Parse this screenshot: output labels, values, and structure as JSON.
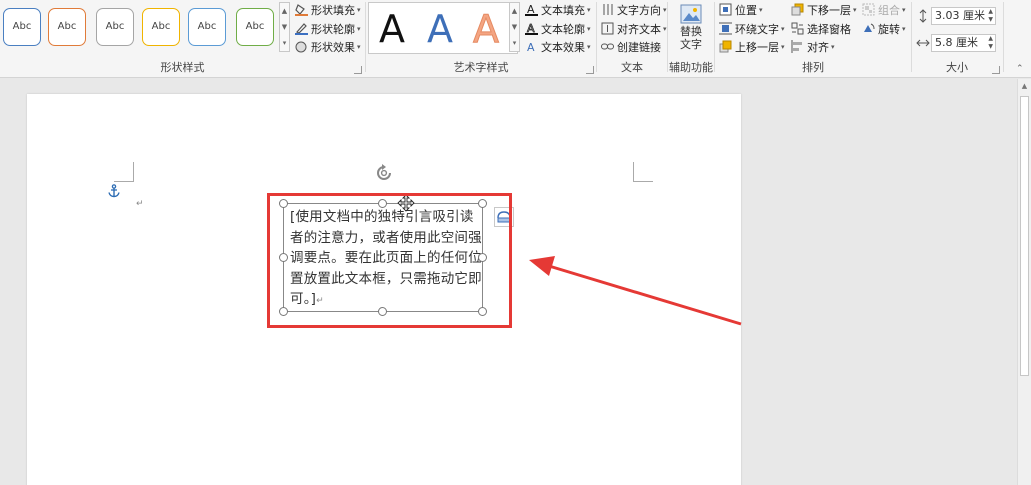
{
  "ribbon": {
    "shape_styles": {
      "label": "形状样式",
      "presets": [
        {
          "text": "Abc",
          "border": "#4a7fc1"
        },
        {
          "text": "Abc",
          "border": "#e07b39"
        },
        {
          "text": "Abc",
          "border": "#a5a5a5"
        },
        {
          "text": "Abc",
          "border": "#f0b400"
        },
        {
          "text": "Abc",
          "border": "#5b9bd5"
        },
        {
          "text": "Abc",
          "border": "#70ad47"
        }
      ],
      "fill": "形状填充",
      "outline": "形状轮廓",
      "effects": "形状效果"
    },
    "wordart": {
      "label": "艺术字样式",
      "samples": [
        {
          "text": "A",
          "color": "#111111"
        },
        {
          "text": "A",
          "color": "#3e6fb8"
        },
        {
          "text": "A",
          "color": "#f4a582"
        }
      ],
      "text_fill": "文本填充",
      "text_outline": "文本轮廓",
      "text_effects": "文本效果"
    },
    "text": {
      "label": "文本",
      "direction": "文字方向",
      "align": "对齐文本",
      "link": "创建链接"
    },
    "accessibility": {
      "label": "辅助功能",
      "alt_text_line1": "替换",
      "alt_text_line2": "文字"
    },
    "arrange": {
      "label": "排列",
      "position": "位置",
      "wrap": "环绕文字",
      "bring_forward": "上移一层",
      "send_backward": "下移一层",
      "selection_pane": "选择窗格",
      "align": "对齐",
      "group": "组合",
      "rotate": "旋转"
    },
    "size": {
      "label": "大小",
      "height": "3.03 厘米",
      "width": "5.8 厘米"
    }
  },
  "document": {
    "paragraph_mark": "↵",
    "textbox_text": "[使用文档中的独特引言吸引读者的注意力，或者使用此空间强调要点。要在此页面上的任何位置放置此文本框，只需拖动它即可。]",
    "textbox_end_mark": "↵"
  },
  "colors": {
    "highlight": "#e53935",
    "anchor": "#2e6db4"
  }
}
